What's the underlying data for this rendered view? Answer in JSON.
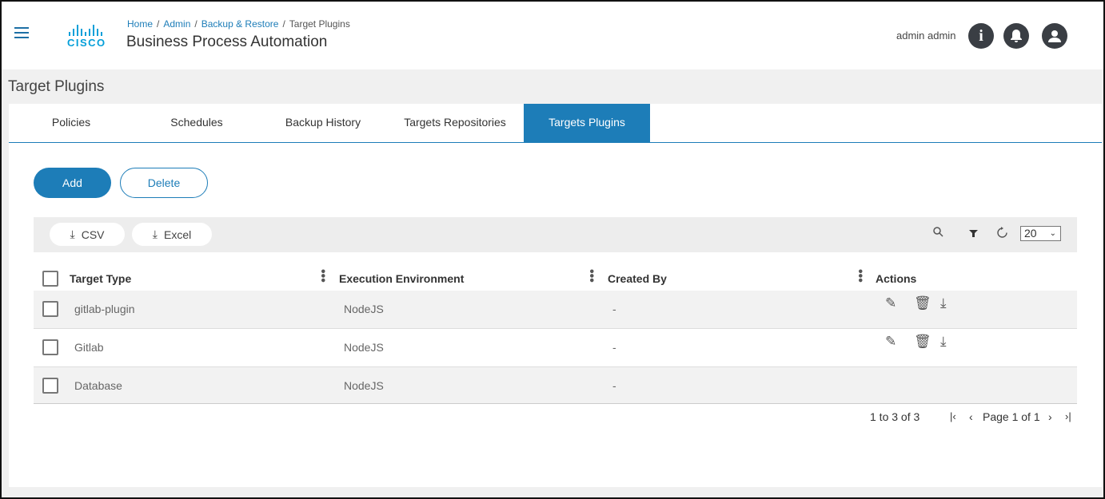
{
  "header": {
    "breadcrumb": [
      "Home",
      "Admin",
      "Backup & Restore",
      "Target Plugins"
    ],
    "app_title": "Business Process Automation",
    "logo_text": "cisco",
    "user_name": "admin admin"
  },
  "page_title": "Target Plugins",
  "tabs": [
    {
      "label": "Policies"
    },
    {
      "label": "Schedules"
    },
    {
      "label": "Backup History"
    },
    {
      "label": "Targets Repositories"
    },
    {
      "label": "Targets Plugins",
      "active": true
    }
  ],
  "buttons": {
    "add": "Add",
    "delete": "Delete"
  },
  "toolbar": {
    "csv": "CSV",
    "excel": "Excel",
    "page_size": "20"
  },
  "table": {
    "columns": [
      "Target Type",
      "Execution Environment",
      "Created By",
      "Actions"
    ],
    "rows": [
      {
        "target_type": "gitlab-plugin",
        "env": "NodeJS",
        "created_by": "-",
        "actions": true
      },
      {
        "target_type": "Gitlab",
        "env": "NodeJS",
        "created_by": "-",
        "actions": true
      },
      {
        "target_type": "Database",
        "env": "NodeJS",
        "created_by": "-",
        "actions": false
      }
    ]
  },
  "pagination": {
    "range": "1 to 3 of 3",
    "page": "Page 1 of 1"
  },
  "colors": {
    "accent": "#1d7db8"
  }
}
